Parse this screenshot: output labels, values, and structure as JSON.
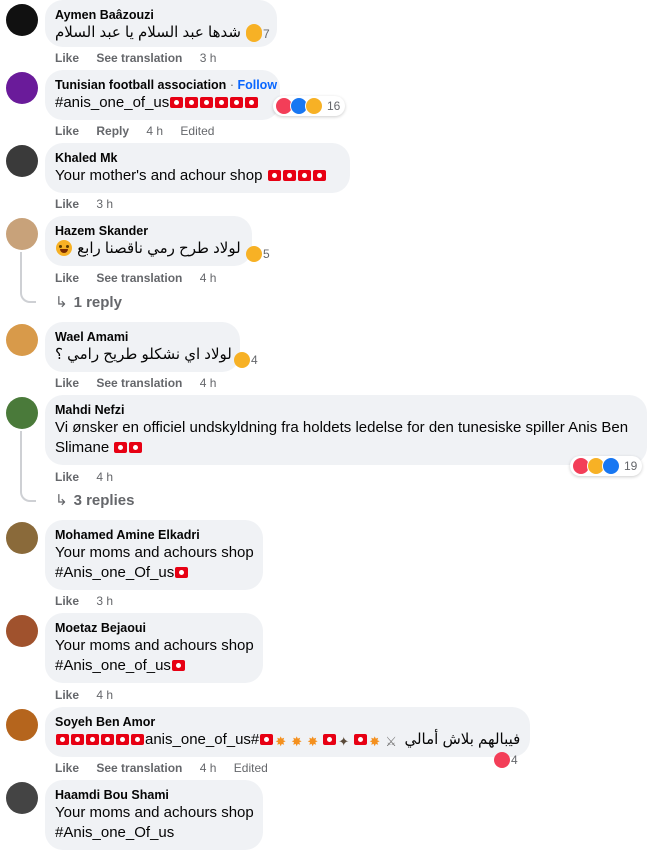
{
  "labels": {
    "like": "Like",
    "see_translation": "See translation",
    "reply": "Reply",
    "edited": "Edited",
    "follow": "Follow",
    "separator": "·"
  },
  "comments": [
    {
      "author": "Aymen Baâzouzi",
      "text": "شدها عبد السلام يا عبد السلام",
      "time": "3 h",
      "reaction_count": "7"
    },
    {
      "author": "Tunisian football association",
      "text": "#anis_one_of_us",
      "time": "4 h",
      "reaction_count": "16"
    },
    {
      "author": "Khaled Mk",
      "text": "Your mother's and achour shop",
      "time": "3 h"
    },
    {
      "author": "Hazem Skander",
      "text": "لولاد طرح رمي ناقصنا رابع",
      "time": "4 h",
      "reaction_count": "5",
      "replies": "1 reply"
    },
    {
      "author": "Wael Amami",
      "text": "لولاد اي نشكلو طريح رامي ؟",
      "time": "4 h",
      "reaction_count": "4"
    },
    {
      "author": "Mahdi Nefzi",
      "text_line1": "Vi ønsker en officiel undskyldning fra holdets ledelse for den tunesiske spiller Anis Ben",
      "text_line2": "Slimane",
      "time": "4 h",
      "reaction_count": "19",
      "replies": "3 replies"
    },
    {
      "author": "Mohamed Amine Elkadri",
      "text_line1": "Your moms and achours shop",
      "text_line2": "#Anis_one_Of_us",
      "time": "3 h"
    },
    {
      "author": "Moetaz Bejaoui",
      "text_line1": "Your moms and achours shop",
      "text_line2": "#Anis_one_of_us",
      "time": "4 h"
    },
    {
      "author": "Soyeh Ben Amor",
      "text_hashtag": "anis_one_of_us#",
      "text_arabic": "فيبالهم بلاش أمالي",
      "time": "4 h",
      "reaction_count": "4"
    },
    {
      "author": "Haamdi Bou Shami",
      "text_line1": "Your moms and achours shop",
      "text_line2": "#Anis_one_Of_us"
    }
  ],
  "colors": {
    "bubble": "#f0f2f5",
    "secondary_text": "#65676b",
    "link": "#0866ff",
    "flag_red": "#e70013"
  }
}
